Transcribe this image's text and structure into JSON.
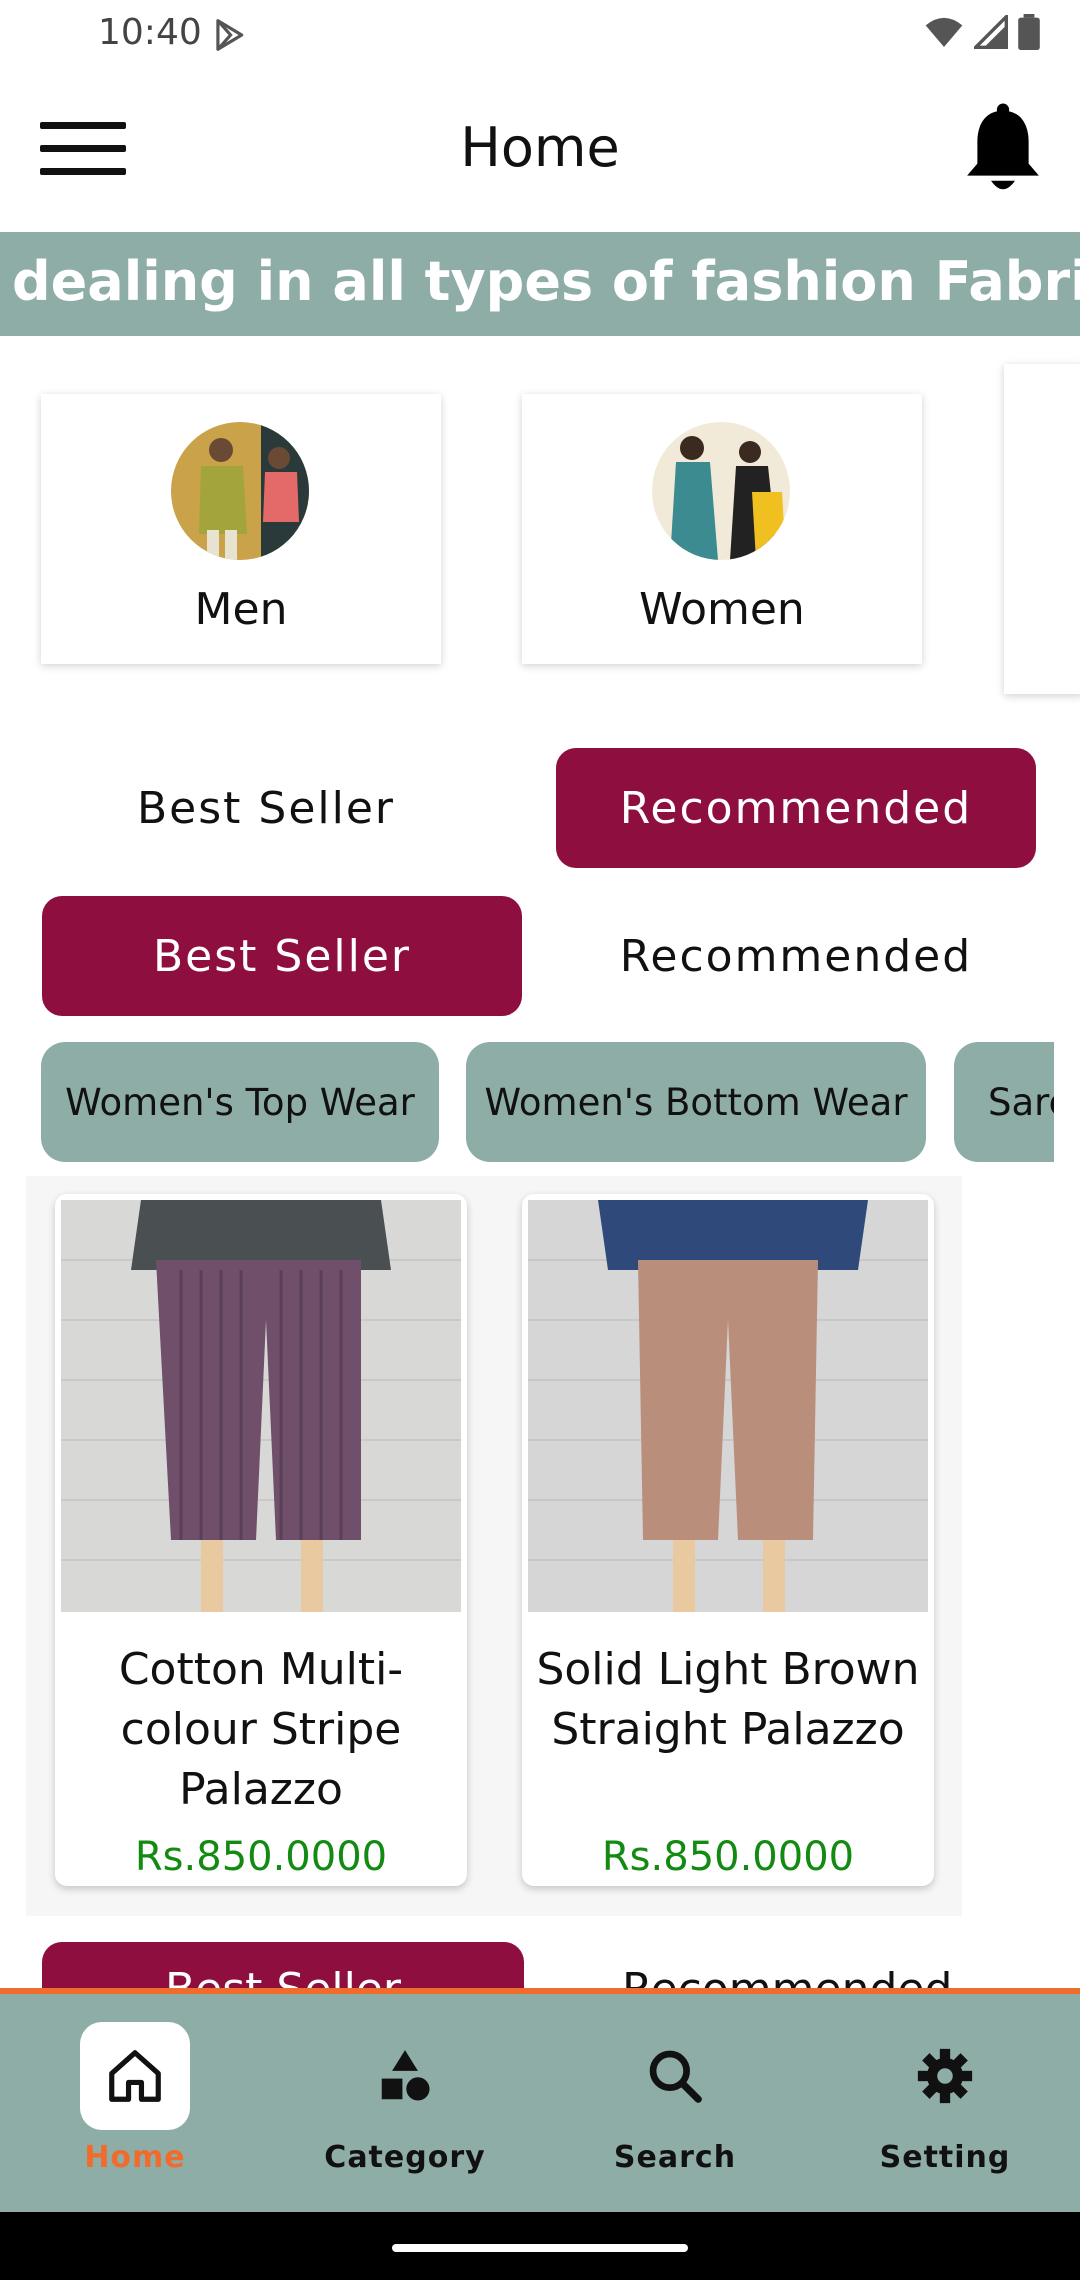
{
  "status_bar": {
    "time": "10:40"
  },
  "app_bar": {
    "title": "Home"
  },
  "marquee": {
    "text": "dealing in all types of fashion Fabrics."
  },
  "categories": [
    {
      "label": "Men"
    },
    {
      "label": "Women"
    }
  ],
  "tabs_top": [
    {
      "label": "Best Seller",
      "active": false
    },
    {
      "label": "Recommended",
      "active": true
    }
  ],
  "tabs_second": [
    {
      "label": "Best Seller",
      "active": true
    },
    {
      "label": "Recommended",
      "active": false
    }
  ],
  "chips": [
    {
      "label": "Women's Top Wear"
    },
    {
      "label": "Women's Bottom Wear"
    },
    {
      "label": "Sarees"
    }
  ],
  "products": [
    {
      "name": "Cotton Multi-colour Stripe Palazzo",
      "price": "Rs.850.0000"
    },
    {
      "name": "Solid Light Brown Straight Palazzo",
      "price": "Rs.850.0000"
    }
  ],
  "next_section_tabs": [
    {
      "label": "Best Seller"
    },
    {
      "label": "Recommended"
    }
  ],
  "bottom_nav": [
    {
      "label": "Home",
      "icon": "home-icon",
      "active": true
    },
    {
      "label": "Category",
      "icon": "category-icon",
      "active": false
    },
    {
      "label": "Search",
      "icon": "search-icon",
      "active": false
    },
    {
      "label": "Setting",
      "icon": "gear-icon",
      "active": false
    }
  ],
  "colors": {
    "brand": "#8e0e40",
    "teal": "#8fada7",
    "accent": "#ef6c2c",
    "price": "#138a12"
  }
}
